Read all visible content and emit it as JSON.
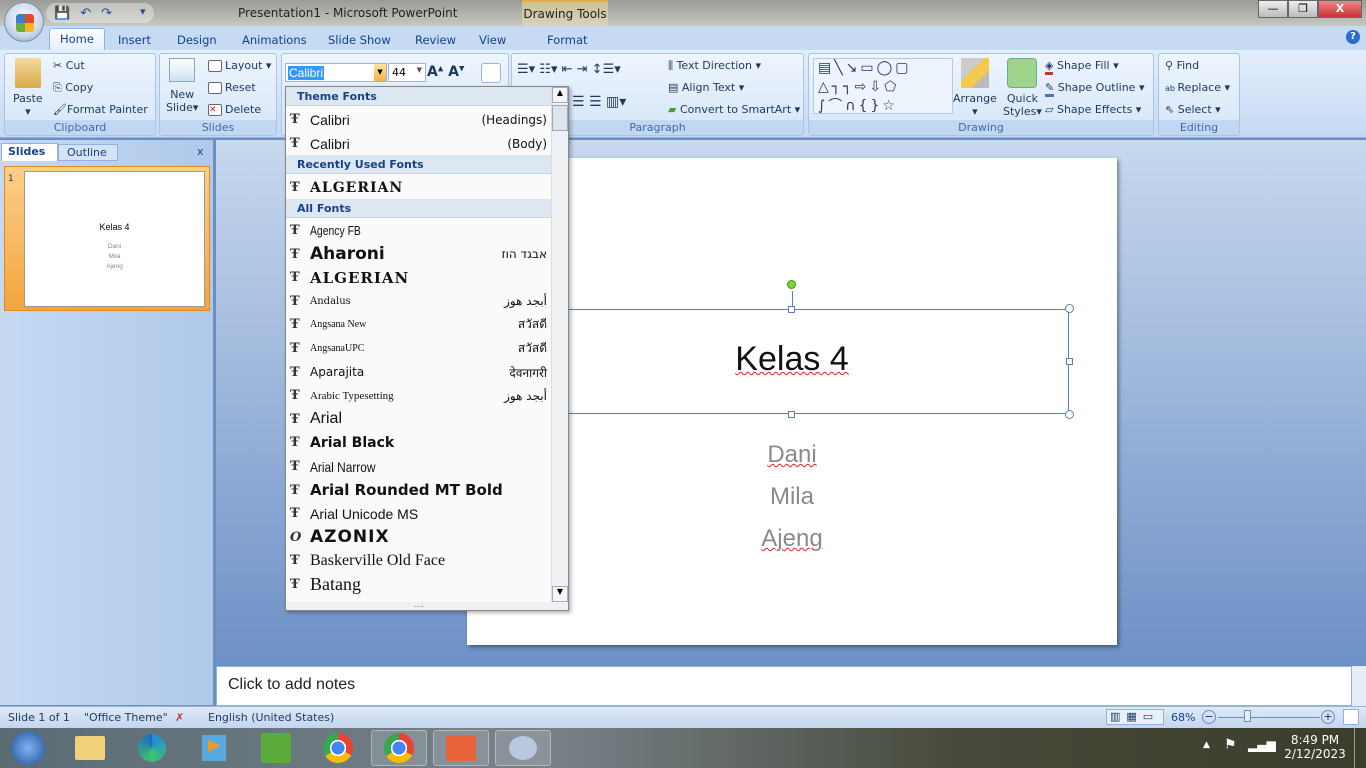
{
  "window": {
    "title": "Presentation1 - Microsoft PowerPoint",
    "context_tab": "Drawing Tools",
    "minimize": "—",
    "restore": "❐",
    "close": "X"
  },
  "tabs": [
    "Home",
    "Insert",
    "Design",
    "Animations",
    "Slide Show",
    "Review",
    "View",
    "Format"
  ],
  "ribbon": {
    "clipboard": {
      "label": "Clipboard",
      "paste": "Paste",
      "cut": "Cut",
      "copy": "Copy",
      "format_painter": "Format Painter"
    },
    "slides": {
      "label": "Slides",
      "new_slide": "New",
      "new_slide2": "Slide",
      "layout": "Layout",
      "reset": "Reset",
      "delete": "Delete"
    },
    "font": {
      "font_name": "Calibri",
      "font_size": "44"
    },
    "paragraph": {
      "label": "Paragraph",
      "text_direction": "Text Direction",
      "align_text": "Align Text",
      "convert_smartart": "Convert to SmartArt"
    },
    "drawing": {
      "label": "Drawing",
      "arrange": "Arrange",
      "quick_styles": "Quick",
      "quick_styles2": "Styles",
      "shape_fill": "Shape Fill",
      "shape_outline": "Shape Outline",
      "shape_effects": "Shape Effects"
    },
    "editing": {
      "label": "Editing",
      "find": "Find",
      "replace": "Replace",
      "select": "Select"
    }
  },
  "font_dropdown": {
    "theme_header": "Theme Fonts",
    "theme": [
      {
        "name": "Calibri",
        "tag": "(Headings)"
      },
      {
        "name": "Calibri",
        "tag": "(Body)"
      }
    ],
    "recent_header": "Recently Used Fonts",
    "recent": [
      {
        "name": "ALGERIAN"
      }
    ],
    "all_header": "All Fonts",
    "all": [
      {
        "name": "Agency FB",
        "sample": ""
      },
      {
        "name": "Aharoni",
        "sample": "אבגד הוז"
      },
      {
        "name": "ALGERIAN",
        "sample": ""
      },
      {
        "name": "Andalus",
        "sample": "أبجد هوز"
      },
      {
        "name": "Angsana New",
        "sample": "สวัสดี"
      },
      {
        "name": "AngsanaUPC",
        "sample": "สวัสดี"
      },
      {
        "name": "Aparajita",
        "sample": "देवनागरी"
      },
      {
        "name": "Arabic Typesetting",
        "sample": "أبجد هوز"
      },
      {
        "name": "Arial",
        "sample": ""
      },
      {
        "name": "Arial Black",
        "sample": ""
      },
      {
        "name": "Arial Narrow",
        "sample": ""
      },
      {
        "name": "Arial Rounded MT Bold",
        "sample": ""
      },
      {
        "name": "Arial Unicode MS",
        "sample": ""
      },
      {
        "name": "AZONIX",
        "sample": ""
      },
      {
        "name": "Baskerville Old Face",
        "sample": ""
      },
      {
        "name": "Batang",
        "sample": ""
      }
    ]
  },
  "left_pane": {
    "tabs": [
      "Slides",
      "Outline"
    ],
    "close": "x",
    "slide_number": "1",
    "thumb_title": "Kelas 4",
    "thumb_lines": [
      "Dani",
      "Mila",
      "Ajeng"
    ]
  },
  "slide": {
    "title": "Kelas 4",
    "subtitle": [
      "Dani",
      "Mila",
      "Ajeng"
    ]
  },
  "notes": {
    "placeholder": "Click to add notes"
  },
  "status": {
    "slide": "Slide 1 of 1",
    "theme": "\"Office Theme\"",
    "language": "English (United States)",
    "zoom": "68%",
    "zoom_percent": 68
  },
  "taskbar": {
    "time": "8:49 PM",
    "date": "2/12/2023",
    "apps": [
      "start",
      "file-explorer",
      "edge",
      "media-player",
      "coreldraw",
      "chrome",
      "chrome-profile",
      "powerpoint",
      "paint"
    ]
  }
}
